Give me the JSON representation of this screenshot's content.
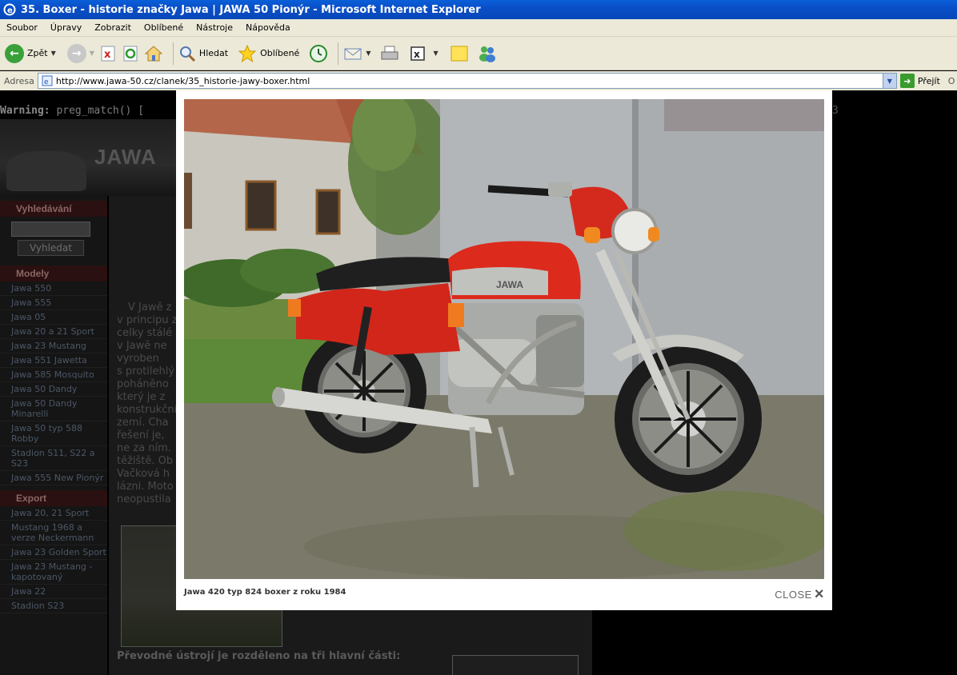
{
  "window": {
    "title": "35. Boxer - historie značky Jawa | JAWA 50 Pionýr - Microsoft Internet Explorer"
  },
  "menu": [
    "Soubor",
    "Úpravy",
    "Zobrazit",
    "Oblíbené",
    "Nástroje",
    "Nápověda"
  ],
  "toolbar": {
    "back_label": "Zpět",
    "search_label": "Hledat",
    "favorites_label": "Oblíbené"
  },
  "address": {
    "label": "Adresa",
    "url": "http://www.jawa-50.cz/clanek/35_historie-jawy-boxer.html",
    "go_label": "Přejít",
    "links_label": "O"
  },
  "page": {
    "warning_label": "Warning:",
    "warning_text": "preg_match() [",
    "warning_tail": "3",
    "logo_text": "JAWA",
    "search_heading": "Vyhledávání",
    "search_button": "Vyhledat",
    "models_heading": "Modely",
    "models": [
      "Jawa 550",
      "Jawa 555",
      "Jawa 05",
      "Jawa 20 a 21 Sport",
      "Jawa 23 Mustang",
      "Jawa 551 Jawetta",
      "Jawa 585 Mosquito",
      "Jawa 50 Dandy",
      "Jawa 50 Dandy Minarelli",
      "Jawa 50 typ 588 Robby",
      "Stadion S11, S22 a S23",
      "Jawa 555 New Pionýr"
    ],
    "export_heading": "Export",
    "export_items": [
      "Jawa 20, 21 Sport",
      "Mustang 1968 a verze Neckermann",
      "Jawa 23 Golden Sport",
      "Jawa 23 Mustang - kapotovaný",
      "Jawa 22",
      "Stadion S23"
    ],
    "content_lines": [
      "V Jawě z",
      "v principu z",
      "celky stálé",
      "v Jawě ne",
      "vyroben",
      "s protilehlý",
      "poháněno",
      "který je z",
      "konstrukční",
      "zemí. Cha",
      "řešení je,",
      "ne za ním.",
      "těžiště. Ob",
      "Vačková h",
      "lázni. Moto",
      "neopustila"
    ],
    "subheading": "Převodné ústrojí je rozděleno na tři hlavní části:"
  },
  "lightbox": {
    "caption": "Jawa 420 typ 824 boxer z roku 1984",
    "close_label": "CLOSE",
    "close_icon": "×"
  },
  "colors": {
    "title_bar": "#0a52c8",
    "chrome": "#ece9d8",
    "bike_red": "#d42a1e",
    "sidebar_heading": "#8c6565"
  }
}
